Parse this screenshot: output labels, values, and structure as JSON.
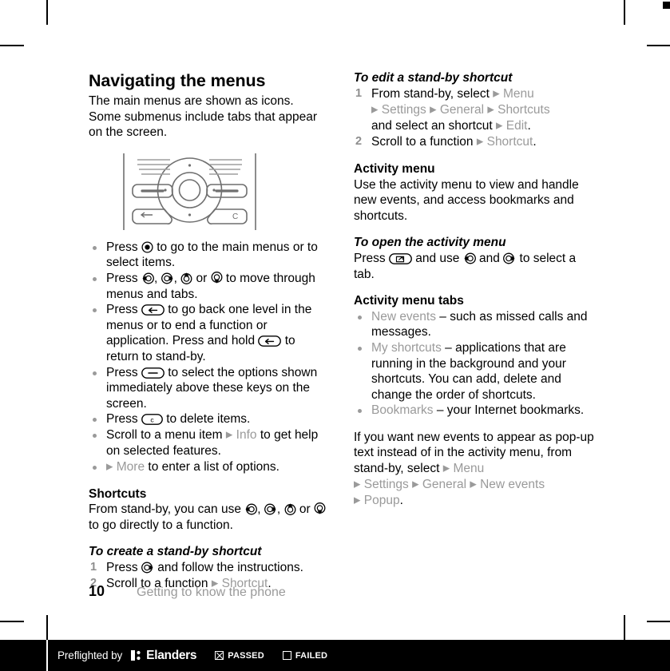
{
  "page": {
    "number": "10",
    "chapter": "Getting to know the phone"
  },
  "left_column": {
    "title": "Navigating the menus",
    "intro": "The main menus are shown as icons. Some submenus include tabs that appear on the screen.",
    "figure_name": "phone-navigation-keys-diagram",
    "bullets": [
      {
        "parts": [
          {
            "t": "text",
            "v": "Press "
          },
          {
            "t": "icon",
            "v": "select-key-icon"
          },
          {
            "t": "text",
            "v": " to go to the main menus or to select items."
          }
        ]
      },
      {
        "parts": [
          {
            "t": "text",
            "v": "Press "
          },
          {
            "t": "icon",
            "v": "nav-left-key-icon"
          },
          {
            "t": "text",
            "v": ", "
          },
          {
            "t": "icon",
            "v": "nav-right-key-icon"
          },
          {
            "t": "text",
            "v": ", "
          },
          {
            "t": "icon",
            "v": "nav-up-key-icon"
          },
          {
            "t": "text",
            "v": " or "
          },
          {
            "t": "icon",
            "v": "nav-down-key-icon"
          },
          {
            "t": "text",
            "v": " to move through menus and tabs."
          }
        ]
      },
      {
        "parts": [
          {
            "t": "text",
            "v": "Press "
          },
          {
            "t": "icon",
            "v": "back-key-icon"
          },
          {
            "t": "text",
            "v": " to go back one level in the menus or to end a function or application. Press and hold "
          },
          {
            "t": "icon",
            "v": "back-key-icon"
          },
          {
            "t": "text",
            "v": " to return to stand-by."
          }
        ]
      },
      {
        "parts": [
          {
            "t": "text",
            "v": "Press "
          },
          {
            "t": "icon",
            "v": "soft-key-icon"
          },
          {
            "t": "text",
            "v": " to select the options shown immediately above these keys on the screen."
          }
        ]
      },
      {
        "parts": [
          {
            "t": "text",
            "v": "Press "
          },
          {
            "t": "icon",
            "v": "clear-key-icon"
          },
          {
            "t": "text",
            "v": " to delete items."
          }
        ]
      },
      {
        "parts": [
          {
            "t": "text",
            "v": "Scroll to a menu item "
          },
          {
            "t": "arrow",
            "v": "▶"
          },
          {
            "t": "gray",
            "v": " Info"
          },
          {
            "t": "text",
            "v": " to get help on selected features."
          }
        ]
      },
      {
        "parts": [
          {
            "t": "arrow",
            "v": "▶"
          },
          {
            "t": "gray",
            "v": " More"
          },
          {
            "t": "text",
            "v": " to enter a list of options."
          }
        ]
      }
    ],
    "shortcuts_heading": "Shortcuts",
    "shortcuts_body": [
      {
        "t": "text",
        "v": "From stand-by, you can use "
      },
      {
        "t": "icon",
        "v": "nav-left-key-icon"
      },
      {
        "t": "text",
        "v": ", "
      },
      {
        "t": "icon",
        "v": "nav-right-key-icon"
      },
      {
        "t": "text",
        "v": ", "
      },
      {
        "t": "icon",
        "v": "nav-up-key-icon"
      },
      {
        "t": "text",
        "v": " or "
      },
      {
        "t": "icon",
        "v": "nav-down-key-icon"
      },
      {
        "t": "text",
        "v": " to go directly to a function."
      }
    ],
    "create_shortcut_heading": "To create a stand-by shortcut",
    "create_shortcut_steps": [
      {
        "parts": [
          {
            "t": "text",
            "v": "Press "
          },
          {
            "t": "icon",
            "v": "nav-right-key-icon"
          },
          {
            "t": "text",
            "v": " and follow the instructions."
          }
        ]
      },
      {
        "parts": [
          {
            "t": "text",
            "v": "Scroll to a function "
          },
          {
            "t": "arrow",
            "v": "▶"
          },
          {
            "t": "gray",
            "v": " Shortcut"
          },
          {
            "t": "text",
            "v": "."
          }
        ]
      }
    ]
  },
  "right_column": {
    "edit_shortcut_heading": "To edit a stand-by shortcut",
    "edit_shortcut_steps": [
      {
        "parts": [
          {
            "t": "text",
            "v": "From stand-by, select "
          },
          {
            "t": "arrow",
            "v": "▶"
          },
          {
            "t": "gray",
            "v": " Menu"
          },
          {
            "t": "break",
            "v": ""
          },
          {
            "t": "arrow",
            "v": "▶"
          },
          {
            "t": "gray",
            "v": " Settings "
          },
          {
            "t": "arrow",
            "v": "▶"
          },
          {
            "t": "gray",
            "v": " General "
          },
          {
            "t": "arrow",
            "v": "▶"
          },
          {
            "t": "gray",
            "v": " Shortcuts"
          },
          {
            "t": "break",
            "v": ""
          },
          {
            "t": "text",
            "v": "and select an shortcut "
          },
          {
            "t": "arrow",
            "v": "▶"
          },
          {
            "t": "gray",
            "v": " Edit"
          },
          {
            "t": "text",
            "v": "."
          }
        ]
      },
      {
        "parts": [
          {
            "t": "text",
            "v": "Scroll to a function "
          },
          {
            "t": "arrow",
            "v": "▶"
          },
          {
            "t": "gray",
            "v": " Shortcut"
          },
          {
            "t": "text",
            "v": "."
          }
        ]
      }
    ],
    "activity_menu_heading": "Activity menu",
    "activity_menu_body": "Use the activity menu to view and handle new events, and access bookmarks and shortcuts.",
    "open_activity_heading": "To open the activity menu",
    "open_activity_body": [
      {
        "t": "text",
        "v": "Press "
      },
      {
        "t": "icon",
        "v": "activity-menu-key-icon"
      },
      {
        "t": "text",
        "v": " and use "
      },
      {
        "t": "icon",
        "v": "nav-left-key-icon"
      },
      {
        "t": "text",
        "v": " and "
      },
      {
        "t": "icon",
        "v": "nav-right-key-icon"
      },
      {
        "t": "text",
        "v": " to select a tab."
      }
    ],
    "tabs_heading": "Activity menu tabs",
    "tabs": [
      {
        "parts": [
          {
            "t": "gray",
            "v": "New events"
          },
          {
            "t": "text",
            "v": " – such as missed calls and messages."
          }
        ]
      },
      {
        "parts": [
          {
            "t": "gray",
            "v": "My shortcuts"
          },
          {
            "t": "text",
            "v": " – applications that are running in the background and your shortcuts. You can add, delete and change the order of shortcuts."
          }
        ]
      },
      {
        "parts": [
          {
            "t": "gray",
            "v": "Bookmarks"
          },
          {
            "t": "text",
            "v": " – your Internet bookmarks."
          }
        ]
      }
    ],
    "popup_paragraph": [
      {
        "t": "text",
        "v": "If you want new events to appear as pop-up text instead of in the activity menu, from stand-by, select "
      },
      {
        "t": "arrow",
        "v": "▶"
      },
      {
        "t": "gray",
        "v": " Menu"
      },
      {
        "t": "break",
        "v": ""
      },
      {
        "t": "arrow",
        "v": "▶"
      },
      {
        "t": "gray",
        "v": " Settings "
      },
      {
        "t": "arrow",
        "v": "▶"
      },
      {
        "t": "gray",
        "v": " General "
      },
      {
        "t": "arrow",
        "v": "▶"
      },
      {
        "t": "gray",
        "v": " New events"
      },
      {
        "t": "break",
        "v": ""
      },
      {
        "t": "arrow",
        "v": "▶"
      },
      {
        "t": "gray",
        "v": " Popup"
      },
      {
        "t": "text",
        "v": "."
      }
    ]
  },
  "preflight": {
    "text": "Preflighted by",
    "brand": "Elanders",
    "passed_label": "PASSED",
    "failed_label": "FAILED",
    "passed_checked": true,
    "failed_checked": false
  },
  "colors": {
    "gray_term": "#9a9a9a",
    "body_text": "#000000",
    "bar_background": "#000000",
    "figure_line": "#6f6f6f"
  }
}
